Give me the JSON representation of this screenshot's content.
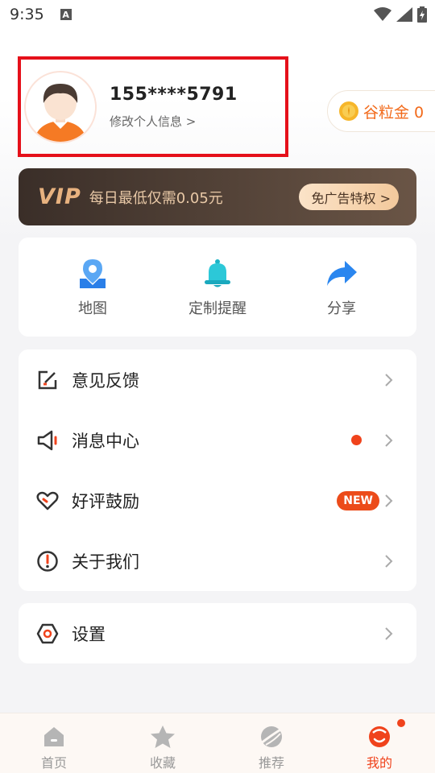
{
  "status_bar": {
    "time": "9:35",
    "a_label": "A"
  },
  "profile": {
    "phone": "155****5791",
    "edit_link": "修改个人信息 >"
  },
  "coins": {
    "label": "谷粒金 0"
  },
  "vip": {
    "logo": "VIP",
    "description": "每日最低仅需0.05元",
    "button_label": "免广告特权 >"
  },
  "quick_actions": [
    {
      "label": "地图",
      "icon": "map-pin-icon"
    },
    {
      "label": "定制提醒",
      "icon": "bell-icon"
    },
    {
      "label": "分享",
      "icon": "share-arrow-icon"
    }
  ],
  "menu": [
    {
      "label": "意见反馈",
      "icon": "feedback-edit-icon"
    },
    {
      "label": "消息中心",
      "icon": "megaphone-icon",
      "has_dot": true
    },
    {
      "label": "好评鼓励",
      "icon": "heart-icon",
      "badge": "NEW"
    },
    {
      "label": "关于我们",
      "icon": "info-circle-icon"
    }
  ],
  "settings": {
    "label": "设置",
    "icon": "settings-hexagon-icon"
  },
  "tabs": [
    {
      "label": "首页",
      "icon": "home-icon",
      "active": false
    },
    {
      "label": "收藏",
      "icon": "star-icon",
      "active": false
    },
    {
      "label": "推荐",
      "icon": "planet-icon",
      "active": false
    },
    {
      "label": "我的",
      "icon": "profile-face-icon",
      "active": true
    }
  ],
  "colors": {
    "accent": "#f0431c",
    "vip_gold": "#e8b27f",
    "highlight_border": "#e5101a"
  }
}
